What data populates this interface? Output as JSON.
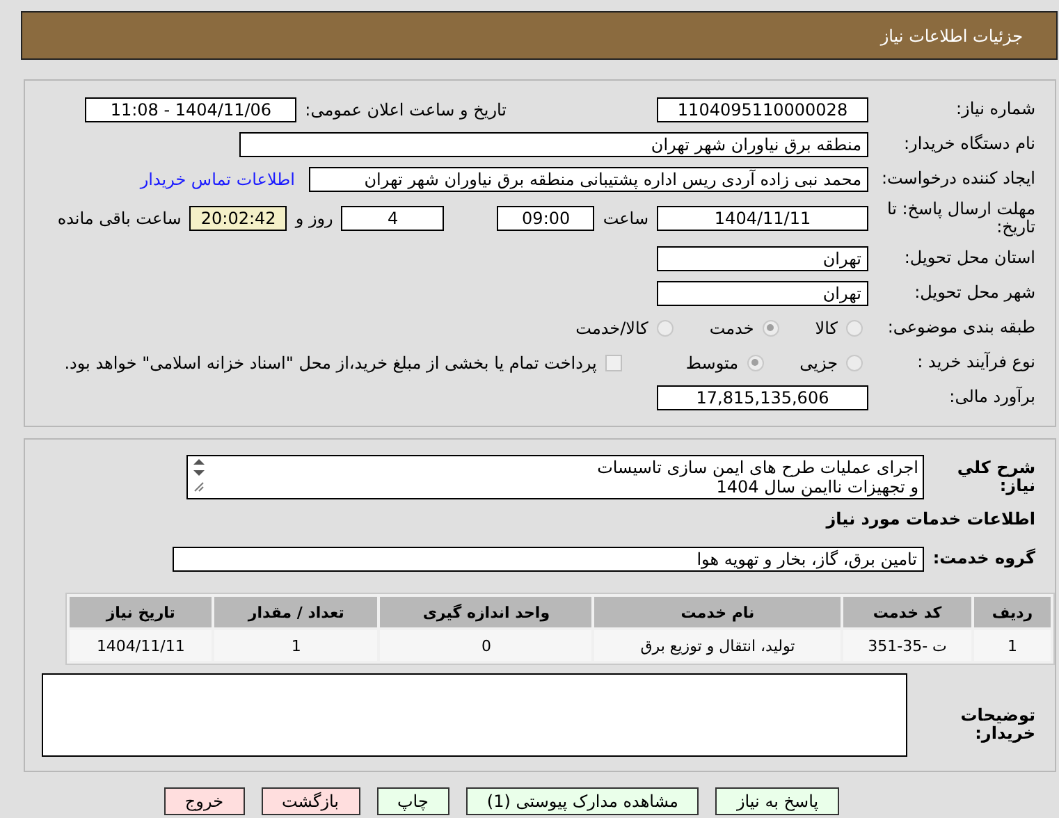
{
  "header": {
    "title": "جزئیات اطلاعات نیاز"
  },
  "need_number": {
    "label": "شماره نیاز:",
    "value": "1104095110000028"
  },
  "announce": {
    "label": "تاریخ و ساعت اعلان عمومی:",
    "value": "1404/11/06 - 11:08"
  },
  "buyer": {
    "label": "نام دستگاه خریدار:",
    "value": "منطقه برق نیاوران شهر تهران"
  },
  "requester": {
    "label": "ایجاد کننده درخواست:",
    "value": "محمد نبی زاده آردی ریس اداره پشتیبانی منطقه برق نیاوران شهر تهران",
    "link": "اطلاعات تماس خریدار"
  },
  "deadline": {
    "label": "مهلت ارسال پاسخ: تا تاریخ:",
    "date": "1404/11/11",
    "time_label": "ساعت",
    "time": "09:00",
    "days": "4",
    "days_label": "روز و",
    "remaining": "20:02:42",
    "remaining_label": "ساعت باقی مانده"
  },
  "province": {
    "label": "استان محل تحویل:",
    "value": "تهران"
  },
  "city": {
    "label": "شهر محل تحویل:",
    "value": "تهران"
  },
  "category": {
    "label": "طبقه بندی موضوعی:",
    "options": [
      {
        "label": "کالا",
        "selected": false
      },
      {
        "label": "خدمت",
        "selected": true
      },
      {
        "label": "کالا/خدمت",
        "selected": false
      }
    ]
  },
  "process": {
    "label": "نوع فرآیند خرید :",
    "options": [
      {
        "label": "جزیی",
        "selected": false
      },
      {
        "label": "متوسط",
        "selected": true
      }
    ],
    "payment": {
      "checked": false,
      "label": "پرداخت تمام یا بخشی از مبلغ خرید،از محل \"اسناد خزانه اسلامی\" خواهد بود."
    }
  },
  "estimate": {
    "label": "برآورد مالی:",
    "value": "17,815,135,606"
  },
  "description": {
    "label": "شرح کلي نياز:",
    "lines": [
      "اجرای عملیات طرح های ایمن سازی تاسیسات",
      "و تجهیزات ناایمن سال 1404"
    ]
  },
  "services_title": "اطلاعات خدمات مورد نیاز",
  "service_group": {
    "label": "گروه خدمت:",
    "value": "تامین برق، گاز، بخار و تهویه هوا"
  },
  "table": {
    "columns": [
      "ردیف",
      "کد خدمت",
      "نام خدمت",
      "واحد اندازه گیری",
      "تعداد / مقدار",
      "تاریخ نیاز"
    ],
    "rows": [
      [
        "1",
        "ت -35-351",
        "تولید، انتقال و توزیع برق",
        "0",
        "1",
        "1404/11/11"
      ]
    ]
  },
  "buyer_notes": {
    "label": "توضیحات خریدار:"
  },
  "buttons": [
    {
      "label": "پاسخ به نیاز",
      "kind": "action"
    },
    {
      "label": "مشاهده مدارک پیوستی (1)",
      "kind": "action"
    },
    {
      "label": "چاپ",
      "kind": "action"
    },
    {
      "label": "بازگشت",
      "kind": "danger"
    },
    {
      "label": "خروج",
      "kind": "danger"
    }
  ]
}
